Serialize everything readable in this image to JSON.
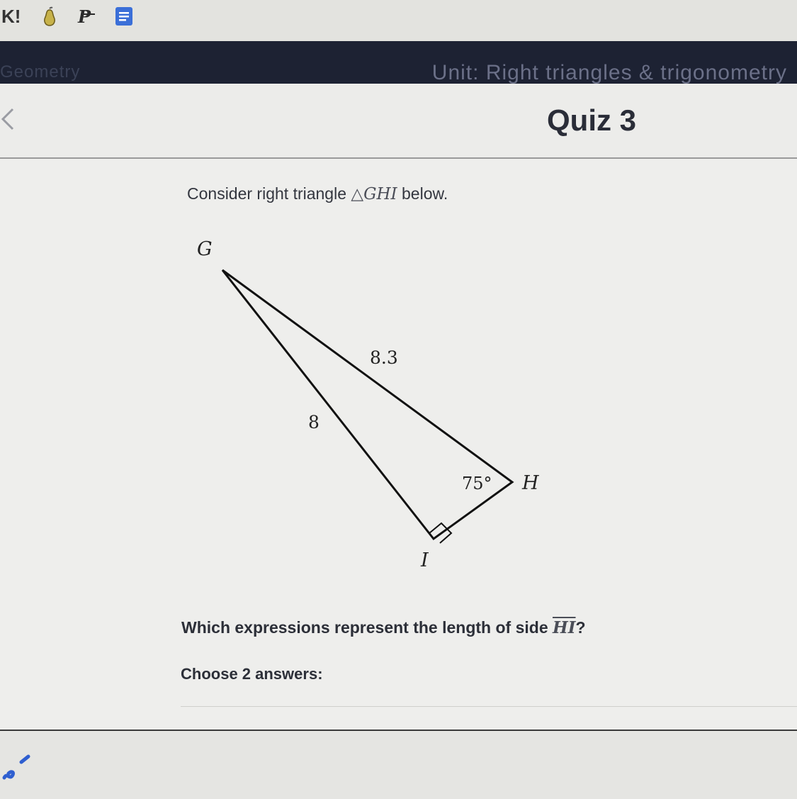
{
  "bookmarks": {
    "k_label": "K!",
    "icons": [
      "pear-icon",
      "pp-logo-icon",
      "document-list-icon"
    ]
  },
  "nav": {
    "course": "Geometry",
    "unit": "Unit: Right triangles & trigonometry"
  },
  "header": {
    "title": "Quiz 3"
  },
  "problem": {
    "prompt_prefix": "Consider right triangle ",
    "triangle_name": "△GHI",
    "prompt_suffix": " below.",
    "figure": {
      "vertex_g": "G",
      "vertex_h": "H",
      "vertex_i": "I",
      "hypotenuse_label": "8.3",
      "side_gi_label": "8",
      "angle_h_label": "75°"
    },
    "question_prefix": "Which expressions represent the length of side ",
    "question_side": "HI",
    "question_suffix": "?",
    "choose": "Choose 2 answers:"
  },
  "colors": {
    "dark_bar": "#1d2233",
    "accent_blue": "#3b6fd8"
  }
}
